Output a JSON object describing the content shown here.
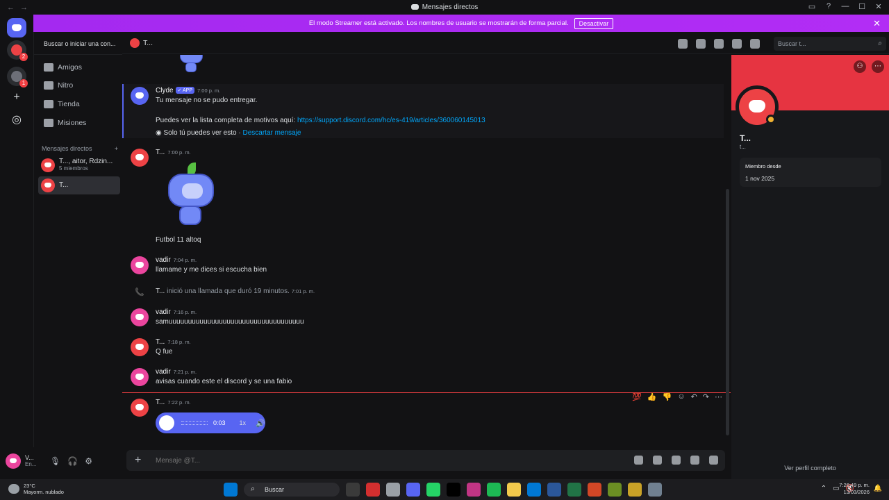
{
  "window": {
    "title": "Mensajes directos",
    "buttons": [
      "▭",
      "?",
      "—",
      "☐",
      "✕"
    ]
  },
  "banner": {
    "text": "El modo Streamer está activado. Los nombres de usuario se mostrarán de forma parcial.",
    "button": "Desactivar"
  },
  "sidebar": {
    "search_placeholder": "Buscar o iniciar una con...",
    "nav": [
      {
        "label": "Amigos",
        "icon": "friends-icon"
      },
      {
        "label": "Nitro",
        "icon": "nitro-icon"
      },
      {
        "label": "Tienda",
        "icon": "shop-icon"
      },
      {
        "label": "Misiones",
        "icon": "quests-icon"
      }
    ],
    "dm_header": "Mensajes directos",
    "dm_add": "+",
    "dms": [
      {
        "name": "T..., aitor, Rdzin...",
        "sub": "5 miembros"
      },
      {
        "name": "T...",
        "sub": ""
      }
    ]
  },
  "user": {
    "name": "V...",
    "status": "En..."
  },
  "header": {
    "name": "T...",
    "search_placeholder": "Buscar t..."
  },
  "messages": {
    "clyde": {
      "author": "Clyde",
      "badge": "✓ APP",
      "time": "7:00 p. m.",
      "line1": "Tu mensaje no se pudo entregar.",
      "line2_prefix": "Puedes ver la lista completa de motivos aquí: ",
      "line2_link": "https://support.discord.com/hc/es-419/articles/360060145013",
      "ephemeral": "Solo tú puedes ver esto · ",
      "dismiss": "Descartar mensaje"
    },
    "t1": {
      "author": "T...",
      "time": "7:00 p. m.",
      "text": "Futbol 11 altoq"
    },
    "v1": {
      "author": "vadir",
      "time": "7:04 p. m.",
      "text": "llamame y me dices si escucha bien"
    },
    "call": {
      "who": "T...",
      "text": " inició una llamada que duró 19 minutos.",
      "time": "7:01 p. m."
    },
    "v2": {
      "author": "vadir",
      "time": "7:16 p. m.",
      "text": "samuuuuuuuuuuuuuuuuuuuuuuuuuuuuuuuuuuu"
    },
    "t2": {
      "author": "T...",
      "time": "7:18 p. m.",
      "text": "Q fue"
    },
    "v3": {
      "author": "vadir",
      "time": "7:21 p. m.",
      "text": "avisas cuando este el discord y se una fabio"
    },
    "t3": {
      "author": "T...",
      "time": "7:22 p. m.",
      "voice": {
        "duration": "0:03",
        "speed": "1x"
      }
    }
  },
  "hover_actions": [
    "💯",
    "👍",
    "👎",
    "☺",
    "↶",
    "↷",
    "⋯"
  ],
  "composer": {
    "placeholder": "Mensaje @T...",
    "plus": "+"
  },
  "profile": {
    "name": "T...",
    "sub": "t...",
    "member_label": "Miembro desde",
    "member_value": "1 nov 2025",
    "full_profile": "Ver perfil completo"
  },
  "taskbar": {
    "weather_temp": "23°C",
    "weather_desc": "Mayorm. nublado",
    "search": "Buscar",
    "time": "7:26:49 p. m.",
    "date": "13/03/2026",
    "app_colors": [
      "#0078d4",
      "#3a3a3a",
      "#d32f2f",
      "#9aa0a6",
      "#5865f2",
      "#25d366",
      "#000000",
      "#c13584",
      "#1db954",
      "#f2c94c",
      "#0078d4",
      "#2b579a",
      "#217346",
      "#d24726",
      "#6b8e23",
      "#c9a227",
      "#708090"
    ]
  },
  "colors": {
    "accent": "#5865f2",
    "banner": "#a429f0",
    "profile_banner": "#e63441",
    "mention_line": "#f23f43"
  }
}
